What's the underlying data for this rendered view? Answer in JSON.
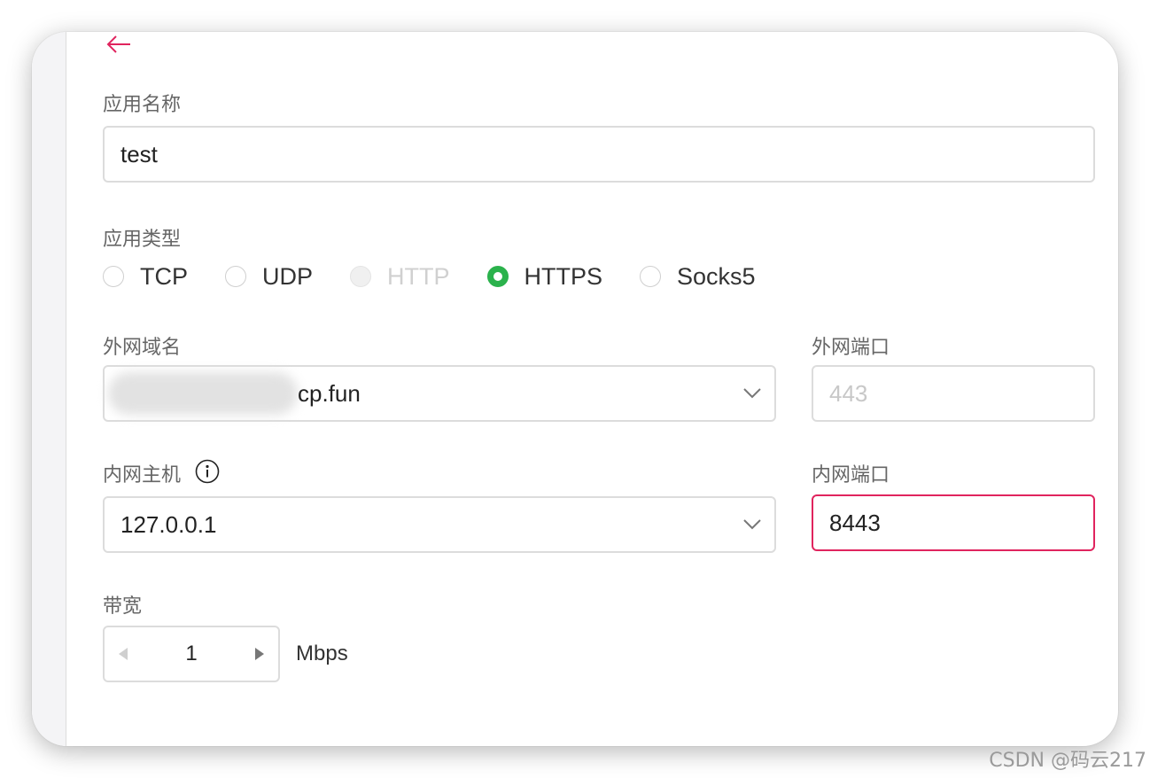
{
  "form": {
    "app_name": {
      "label": "应用名称",
      "value": "test"
    },
    "app_type": {
      "label": "应用类型",
      "options": [
        {
          "label": "TCP",
          "state": "unchecked"
        },
        {
          "label": "UDP",
          "state": "unchecked"
        },
        {
          "label": "HTTP",
          "state": "disabled"
        },
        {
          "label": "HTTPS",
          "state": "checked"
        },
        {
          "label": "Socks5",
          "state": "unchecked"
        }
      ]
    },
    "external_domain": {
      "label": "外网域名",
      "value_suffix": "cp.fun"
    },
    "external_port": {
      "label": "外网端口",
      "placeholder": "443"
    },
    "internal_host": {
      "label": "内网主机",
      "value": "127.0.0.1",
      "info_icon": "info-icon"
    },
    "internal_port": {
      "label": "内网端口",
      "value": "8443",
      "state": "error"
    },
    "bandwidth": {
      "label": "带宽",
      "value": "1",
      "unit": "Mbps"
    }
  },
  "colors": {
    "accent_error": "#e0245e",
    "radio_checked": "#2bb24c",
    "back_arrow": "#e0245e"
  },
  "icons": {
    "back": "arrow-left-icon",
    "dropdown": "chevron-down-icon",
    "stepper_decrease": "triangle-left-icon",
    "stepper_increase": "triangle-right-icon"
  },
  "watermark": "CSDN @码云217"
}
